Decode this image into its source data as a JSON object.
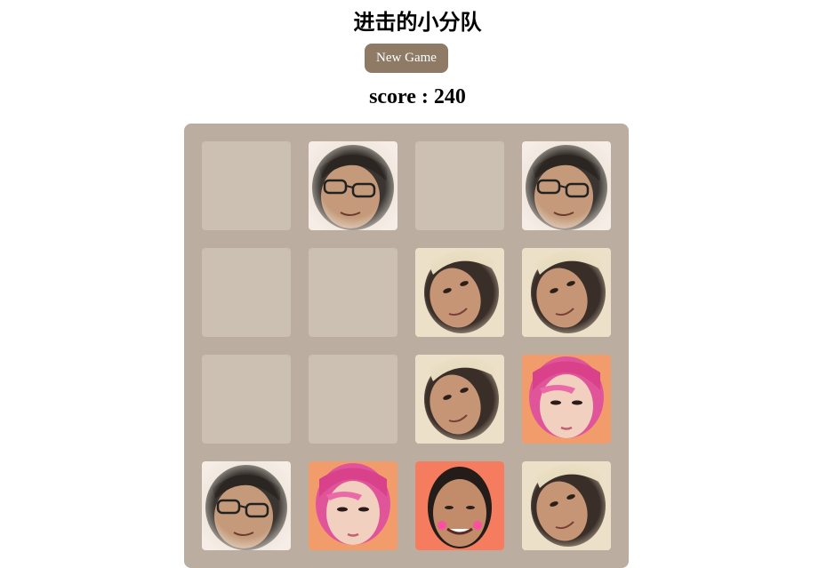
{
  "header": {
    "title": "进击的小分队",
    "new_game_label": "New Game",
    "score_label": "score : 240"
  },
  "board": {
    "rows": 4,
    "cols": 4,
    "tiles": [
      [
        "empty",
        "glasses-face",
        "empty",
        "glasses-face"
      ],
      [
        "empty",
        "empty",
        "tilted-face",
        "tilted-face"
      ],
      [
        "empty",
        "empty",
        "tilted-face",
        "pink-hair-face"
      ],
      [
        "glasses-face",
        "pink-hair-face",
        "smiling-man-face",
        "tilted-face"
      ]
    ]
  },
  "colors": {
    "board": "#bbada0",
    "empty_cell": "#ccc0b3",
    "button": "#8f7a66"
  }
}
